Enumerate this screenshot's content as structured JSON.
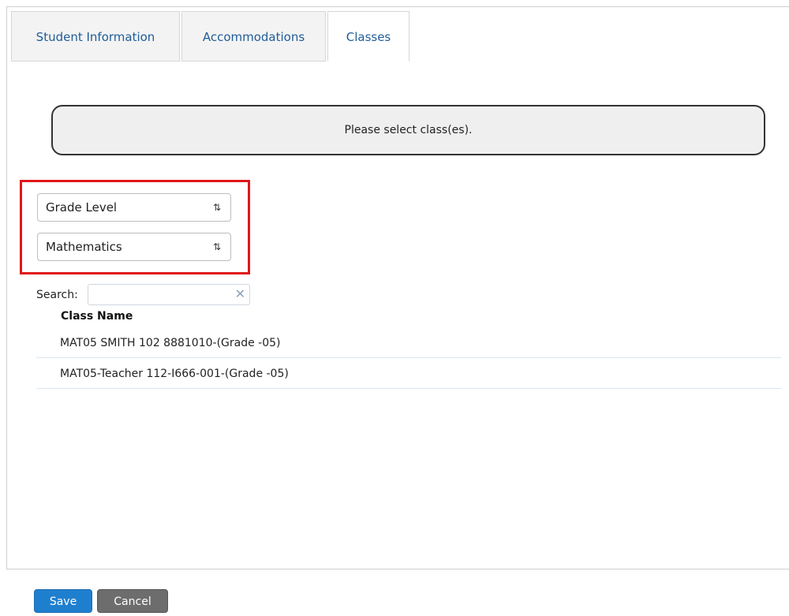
{
  "tabs": [
    {
      "label": "Student Information",
      "active": false
    },
    {
      "label": "Accommodations",
      "active": false
    },
    {
      "label": "Classes",
      "active": true
    }
  ],
  "message": "Please select class(es).",
  "filters": {
    "grade_level": "Grade Level",
    "subject": "Mathematics"
  },
  "search": {
    "label": "Search:",
    "value": "",
    "clear_icon": "✕"
  },
  "table": {
    "column_header": "Class Name",
    "rows": [
      "MAT05 SMITH 102 8881010-(Grade -05)",
      "MAT05-Teacher 112-I666-001-(Grade -05)"
    ]
  },
  "buttons": {
    "save": "Save",
    "cancel": "Cancel"
  },
  "colors": {
    "highlight": "#e0161a",
    "tab_text": "#1f5c99",
    "save_button": "#1f7fcf",
    "cancel_button": "#6d6d6d"
  }
}
